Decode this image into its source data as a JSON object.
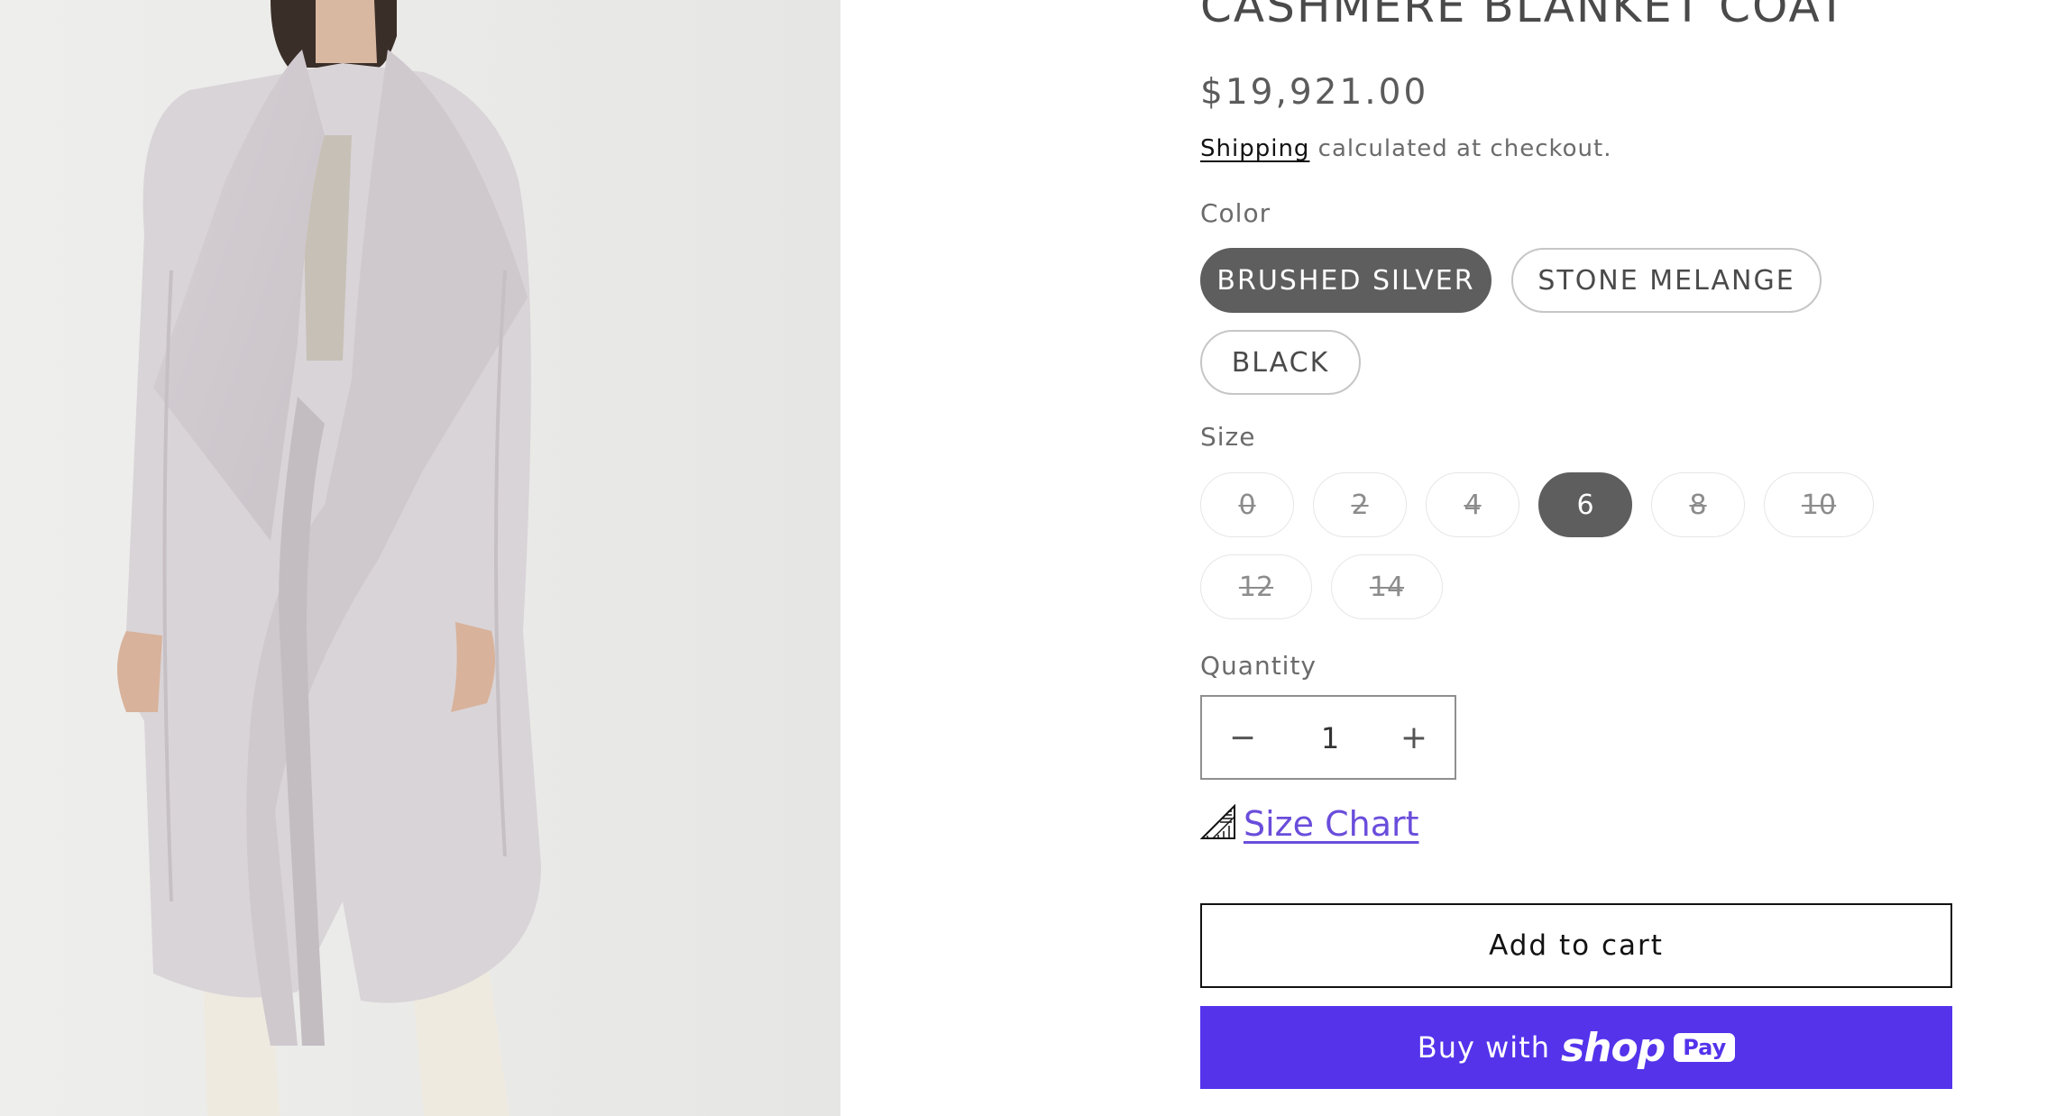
{
  "product": {
    "title": "CASHMERE BLANKET COAT",
    "price": "$19,921.00",
    "shipping_link": "Shipping",
    "shipping_suffix": " calculated at checkout."
  },
  "color": {
    "label": "Color",
    "options": [
      "BRUSHED SILVER",
      "STONE MELANGE",
      "BLACK"
    ],
    "selected": "BRUSHED SILVER"
  },
  "size": {
    "label": "Size",
    "options": [
      "0",
      "2",
      "4",
      "6",
      "8",
      "10",
      "12",
      "14"
    ],
    "selected": "6",
    "unavailable": [
      "0",
      "2",
      "4",
      "8",
      "10",
      "12",
      "14"
    ]
  },
  "quantity": {
    "label": "Quantity",
    "value": "1",
    "decrease_symbol": "−",
    "increase_symbol": "+"
  },
  "size_chart": {
    "label": "Size Chart",
    "icon": "ruler-icon"
  },
  "actions": {
    "add_to_cart": "Add to cart",
    "buy_with": "Buy with",
    "shop_logo": "shop",
    "pay_badge": "Pay"
  },
  "colors": {
    "selected_fill": "#5e5e5e",
    "shop_pay": "#5433eb",
    "size_chart_link": "#6a4ddb",
    "image_background": "#ebebe9",
    "coat": "#d9d4d8"
  }
}
